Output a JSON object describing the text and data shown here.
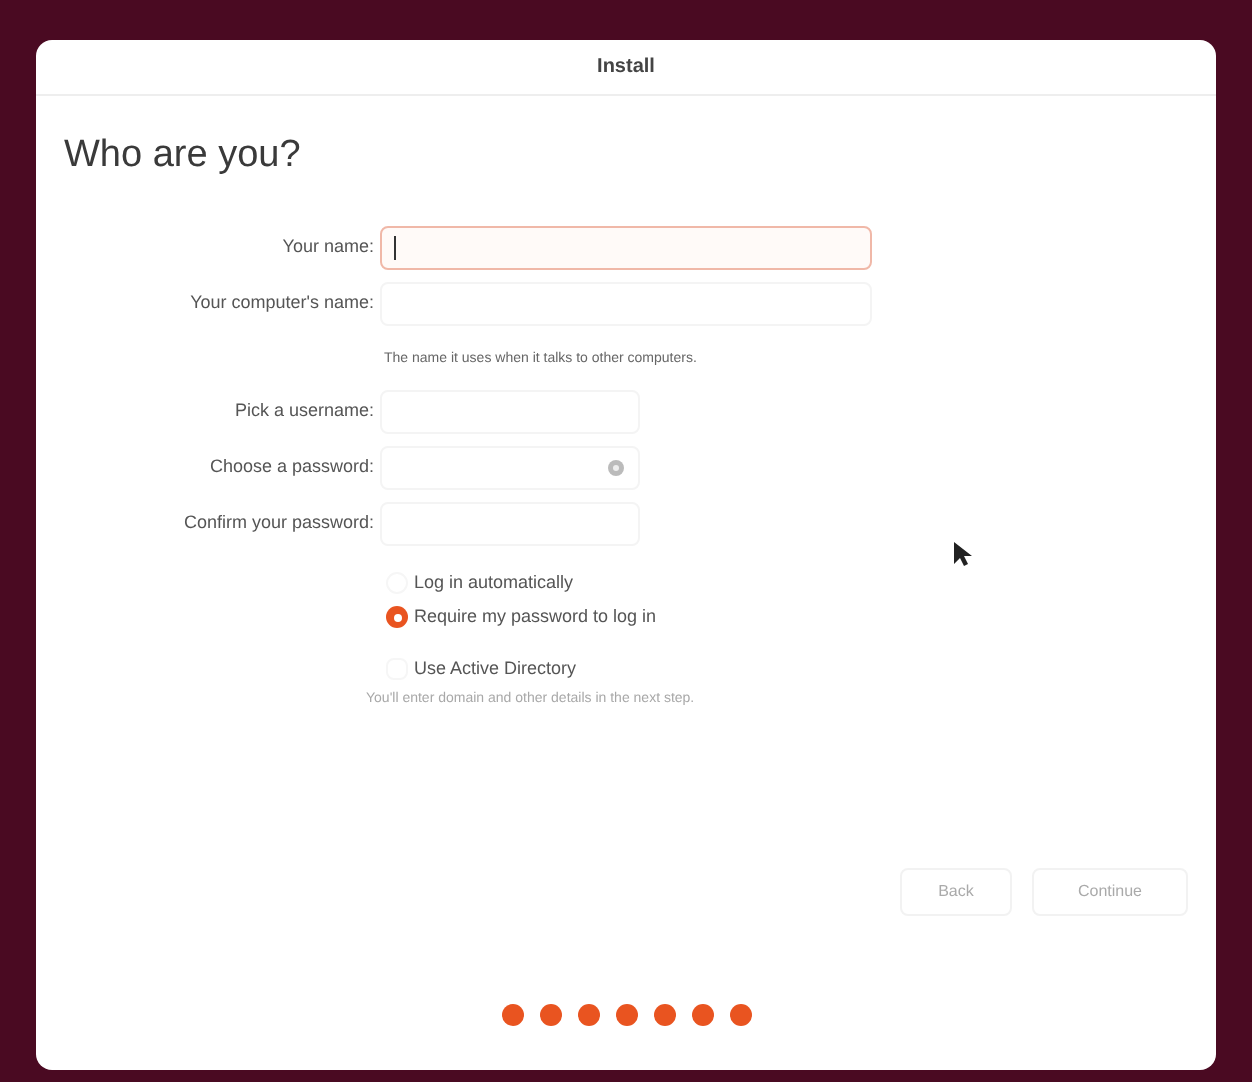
{
  "window": {
    "title": "Install"
  },
  "heading": "Who are you?",
  "fields": [
    {
      "label": "Your name:",
      "kind": "wide",
      "focused": true,
      "has_eye": false
    },
    {
      "label": "Your computer's name:",
      "kind": "wide",
      "focused": false,
      "has_eye": false,
      "hint": "The name it uses when it talks to other computers."
    },
    {
      "label": "Pick a username:",
      "kind": "narrow",
      "focused": false,
      "has_eye": false
    },
    {
      "label": "Choose a password:",
      "kind": "narrow",
      "focused": false,
      "has_eye": true
    },
    {
      "label": "Confirm your password:",
      "kind": "narrow",
      "focused": false,
      "has_eye": false
    }
  ],
  "login_options": [
    {
      "label": "Log in automatically",
      "selected": false
    },
    {
      "label": "Require my password to log in",
      "selected": true
    }
  ],
  "active_directory": {
    "label": "Use Active Directory",
    "checked": false,
    "hint": "You'll enter domain and other details in the next step."
  },
  "buttons": [
    {
      "label": "Back",
      "disabled": true
    },
    {
      "label": "Continue",
      "disabled": true
    }
  ],
  "steps": [
    {
      "done": true
    },
    {
      "done": true
    },
    {
      "done": true
    },
    {
      "done": true
    },
    {
      "done": true
    },
    {
      "done": true
    },
    {
      "done": true
    }
  ]
}
